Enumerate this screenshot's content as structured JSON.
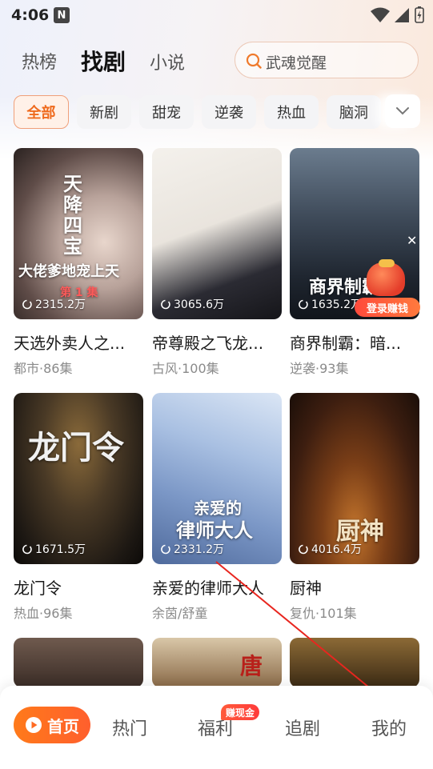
{
  "status_bar": {
    "time": "4:06",
    "notification_badge": "N"
  },
  "header": {
    "tabs": [
      {
        "label": "热榜",
        "active": false
      },
      {
        "label": "找剧",
        "active": true
      },
      {
        "label": "小说",
        "active": false
      }
    ],
    "search": {
      "placeholder": "武魂觉醒"
    }
  },
  "categories": [
    {
      "label": "全部",
      "active": true
    },
    {
      "label": "新剧",
      "active": false
    },
    {
      "label": "甜宠",
      "active": false
    },
    {
      "label": "逆袭",
      "active": false
    },
    {
      "label": "热血",
      "active": false
    },
    {
      "label": "脑洞",
      "active": false
    }
  ],
  "dramas": [
    {
      "title": "天选外卖人之...",
      "meta": "都市·86集",
      "plays": "2315.2万"
    },
    {
      "title": "帝尊殿之飞龙...",
      "meta": "古风·100集",
      "plays": "3065.6万"
    },
    {
      "title": "商界制霸：暗...",
      "meta": "逆袭·93集",
      "plays": "1635.2万"
    },
    {
      "title": "龙门令",
      "meta": "热血·96集",
      "plays": "1671.5万"
    },
    {
      "title": "亲爱的律师大人",
      "meta": "余茵/舒童",
      "plays": "2331.2万"
    },
    {
      "title": "厨神",
      "meta": "复仇·101集",
      "plays": "4016.4万"
    }
  ],
  "poster_texts": {
    "p1": "天降四宝",
    "p1b": "大佬爹地宠上天",
    "p1c": "第 1 集",
    "p3": "商界制霸",
    "p4": "龙门令",
    "p5": "亲爱的",
    "p5b": "律师大人",
    "p6": "厨神",
    "p8": "唐"
  },
  "promo": {
    "login_reward": "登录赚钱"
  },
  "bottom_nav": {
    "home": "首页",
    "hot": "热门",
    "welfare": "福利",
    "welfare_badge": "赚现金",
    "follow": "追剧",
    "mine": "我的"
  },
  "colors": {
    "accent": "#ef6a1d",
    "nav_gradient_start": "#ff7a1a",
    "nav_gradient_end": "#ff5f2d"
  }
}
